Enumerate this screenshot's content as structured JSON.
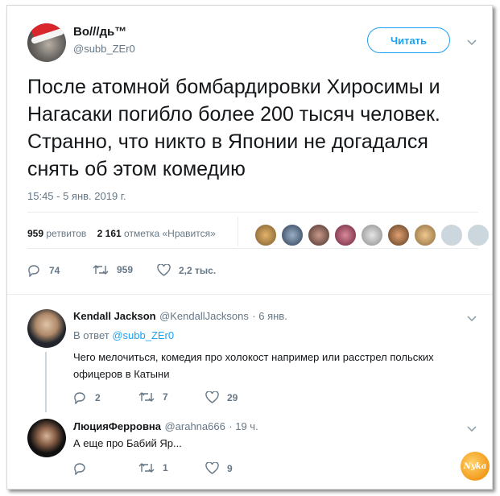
{
  "tweet": {
    "author_name": "Bo///дь™",
    "author_handle": "@subb_ZEr0",
    "follow_label": "Читать",
    "text": "После атомной бомбардировки Хиросимы и Нагасаки погибло более 200 тысяч человек. Странно, что никто в Японии не догадался снять об этом комедию",
    "timestamp": "15:45 - 5 янв. 2019 г.",
    "retweets_count": "959",
    "retweets_label": "ретвитов",
    "likes_count": "2 161",
    "likes_label": "отметка «Нравится»",
    "actions": {
      "reply_count": "74",
      "retweet_count": "959",
      "like_count": "2,2 тыс."
    }
  },
  "replies": [
    {
      "name": "Kendall Jackson",
      "handle": "@KendallJacksons",
      "time": "· 6 янв.",
      "reply_to_prefix": "В ответ",
      "reply_to_handle": "@subb_ZEr0",
      "text": "Чего мелочиться, комедия про холокост например или расстрел польских офицеров в Катыни",
      "reply_count": "2",
      "retweet_count": "7",
      "like_count": "29"
    },
    {
      "name": "ЛюцияФерровна",
      "handle": "@arahna666",
      "time": "· 19 ч.",
      "text": "А еще про Бабий Яр...",
      "reply_count": "",
      "retweet_count": "1",
      "like_count": "9"
    }
  ],
  "watermark_text": "Nyka",
  "colors": {
    "accent": "#1da1f2",
    "text": "#14171a",
    "muted": "#657786"
  }
}
